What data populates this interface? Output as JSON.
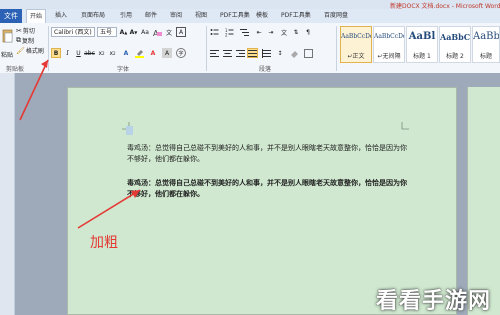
{
  "window": {
    "title": "新建DOCX 文档.docx - Microsoft Word"
  },
  "tabs": {
    "file": "文件",
    "items": [
      "开始",
      "插入",
      "页面布局",
      "引用",
      "邮件",
      "审阅",
      "视图",
      "PDF工具集",
      "模板",
      "PDF工具集",
      "百度网盘"
    ]
  },
  "clipboard": {
    "paste": "粘贴",
    "cut": "剪切",
    "copy": "复制",
    "format_painter": "格式刷",
    "label": "剪贴板"
  },
  "font": {
    "name": "Calibri (西文)",
    "size": "五号",
    "label": "字体"
  },
  "paragraph": {
    "label": "段落"
  },
  "styles": {
    "items": [
      {
        "preview": "AaBbCcDd",
        "name": "↵正文"
      },
      {
        "preview": "AaBbCcDd",
        "name": "↵无间隔"
      },
      {
        "preview": "AaBl",
        "name": "标题 1"
      },
      {
        "preview": "AaBbC",
        "name": "标题 2"
      },
      {
        "preview": "AaBb",
        "name": "标题"
      }
    ]
  },
  "document": {
    "para1": "毒鸡汤：总觉得自己总碰不到美好的人和事，并不是别人眼瞎老天故意整你，恰恰是因为你不够好，他们都在躲你。",
    "para2": "毒鸡汤：总觉得自己总碰不到美好的人和事，并不是别人眼瞎老天故意整你，恰恰是因为你不够好，他们都在躲你。"
  },
  "annotation": {
    "label": "加粗",
    "color": "#e53935"
  },
  "watermark": "看看手游网"
}
